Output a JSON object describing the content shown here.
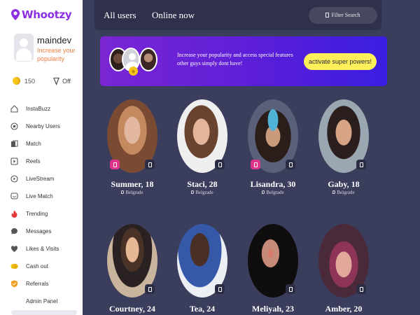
{
  "app": {
    "logo_text": "Whootzy",
    "brand_color": "#8b2fe0"
  },
  "profile": {
    "username": "maindev",
    "tagline": "Increase your popularity",
    "coins": "150",
    "boost_status": "Off"
  },
  "sidebar": {
    "items": [
      {
        "label": "InstaBuzz",
        "icon": "home-icon",
        "color": "#555555"
      },
      {
        "label": "Nearby Users",
        "icon": "location-icon",
        "color": "#555555"
      },
      {
        "label": "Match",
        "icon": "cards-icon",
        "color": "#555555"
      },
      {
        "label": "Reels",
        "icon": "play-icon",
        "color": "#555555"
      },
      {
        "label": "LiveStream",
        "icon": "broadcast-icon",
        "color": "#555555"
      },
      {
        "label": "Live Match",
        "icon": "chat-smile-icon",
        "color": "#555555"
      },
      {
        "label": "Trending",
        "icon": "fire-icon",
        "color": "#e83a3a"
      },
      {
        "label": "Messages",
        "icon": "message-icon",
        "color": "#555555"
      },
      {
        "label": "Likes & Visits",
        "icon": "heart-icon",
        "color": "#555555"
      },
      {
        "label": "Cash out",
        "icon": "coins-icon",
        "color": "#f5c518"
      },
      {
        "label": "Referrals",
        "icon": "shield-icon",
        "color": "#f0a020"
      },
      {
        "label": "Admin Panel",
        "icon": "",
        "color": "#555555"
      }
    ]
  },
  "header": {
    "tabs": [
      "All users",
      "Online now"
    ],
    "filter_label": "Filter Search"
  },
  "promo": {
    "text": "Increase your popularity and access special features other guys simply dont have!",
    "button_label": "activate super powers!"
  },
  "users": [
    {
      "name": "Summer, 18",
      "location": "Belgrade",
      "has_story": true,
      "photo_bg": "#6a4b3d"
    },
    {
      "name": "Staci, 28",
      "location": "Belgrade",
      "has_story": false,
      "photo_bg": "#5a3b2f"
    },
    {
      "name": "Lisandra, 30",
      "location": "Belgrade",
      "has_story": true,
      "photo_bg": "#2e2a30"
    },
    {
      "name": "Gaby, 18",
      "location": "Belgrade",
      "has_story": false,
      "photo_bg": "#7a8a96"
    },
    {
      "name": "Courtney, 24",
      "location": "",
      "has_story": false,
      "photo_bg": "#7d6a58"
    },
    {
      "name": "Tea, 24",
      "location": "",
      "has_story": false,
      "photo_bg": "#3d4e78"
    },
    {
      "name": "Meliyah, 23",
      "location": "",
      "has_story": false,
      "photo_bg": "#1e1a1c"
    },
    {
      "name": "Amber, 20",
      "location": "",
      "has_story": false,
      "photo_bg": "#6a3050"
    }
  ]
}
